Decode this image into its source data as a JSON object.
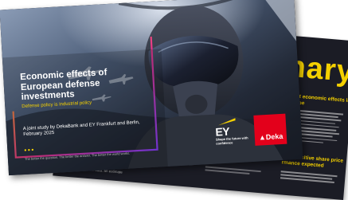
{
  "cover": {
    "title": "Economic effects of European defense investments",
    "subtitle": "Defense policy is industrial policy",
    "study": "A joint study by DekaBank and EY Frankfurt and Berlin, February 2025",
    "footer": "The better the question. The better the answer. The better the world works."
  },
  "logos": {
    "ey": "EY",
    "ey_tagline": "Shape the future with confidence",
    "deka": "▲Deka"
  },
  "back_page": {
    "heading_fragment": "nary",
    "section_1": "ficant economic effects in Europe",
    "section_2": "term positive share price rmance expected",
    "footer": "1 Based on no data. an estimate"
  },
  "colors": {
    "accent_yellow": "#f4d000",
    "frame_gradient": [
      "#f4d000",
      "#e8388a",
      "#8a3ffc"
    ],
    "deka_red": "#e3001b",
    "page_dark": "#1b1c25"
  }
}
